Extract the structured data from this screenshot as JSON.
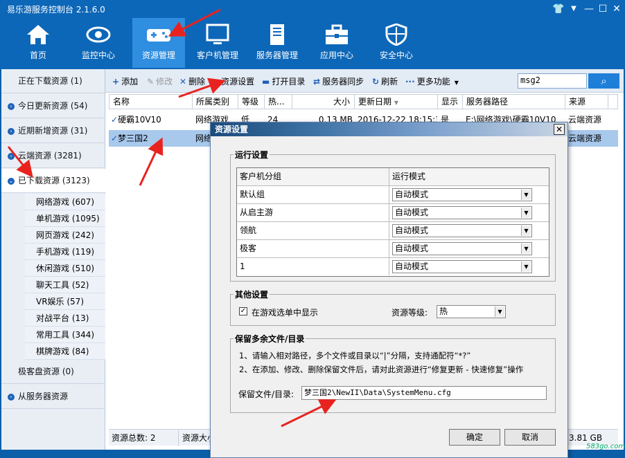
{
  "window": {
    "title": "易乐游服务控制台 2.1.6.0"
  },
  "nav": [
    {
      "label": "首页",
      "icon": "home-icon"
    },
    {
      "label": "监控中心",
      "icon": "eye-icon"
    },
    {
      "label": "资源管理",
      "icon": "gamepad-icon"
    },
    {
      "label": "客户机管理",
      "icon": "monitor-icon"
    },
    {
      "label": "服务器管理",
      "icon": "server-icon"
    },
    {
      "label": "应用中心",
      "icon": "toolbox-icon"
    },
    {
      "label": "安全中心",
      "icon": "shield-icon"
    }
  ],
  "sidebar": {
    "top": [
      {
        "label": "正在下载资源 (1)"
      },
      {
        "label": "今日更新资源 (54)"
      },
      {
        "label": "近期新增资源 (31)"
      },
      {
        "label": "云端资源 (3281)"
      },
      {
        "label": "已下载资源 (3123)"
      }
    ],
    "sub": [
      {
        "label": "网络游戏 (607)"
      },
      {
        "label": "单机游戏 (1095)"
      },
      {
        "label": "网页游戏 (242)"
      },
      {
        "label": "手机游戏 (119)"
      },
      {
        "label": "休闲游戏 (510)"
      },
      {
        "label": "聊天工具 (52)"
      },
      {
        "label": "VR娱乐 (57)"
      },
      {
        "label": "对战平台 (13)"
      },
      {
        "label": "常用工具 (344)"
      },
      {
        "label": "棋牌游戏 (84)"
      }
    ],
    "bottom": [
      {
        "label": "极客盘资源 (0)"
      },
      {
        "label": "从服务器资源"
      }
    ]
  },
  "toolbar": {
    "add": "添加",
    "edit": "修改",
    "delete": "删除",
    "settings": "资源设置",
    "open_dir": "打开目录",
    "sync": "服务器同步",
    "refresh": "刷新",
    "more": "更多功能",
    "search_value": "msg2"
  },
  "grid": {
    "headers": [
      "名称",
      "所属类别",
      "等级",
      "热...",
      "大小",
      "更新日期",
      "显示",
      "服务器路径",
      "来源"
    ],
    "rows": [
      {
        "name": "硬霸10V10",
        "category": "网络游戏",
        "level": "低",
        "heat": "24",
        "size": "0.13 MB",
        "date": "2016-12-22 18:15:30",
        "show": "是",
        "path": "E:\\网络游戏\\硬霸10V10",
        "source": "云端资源"
      },
      {
        "name": "梦三国2",
        "category": "网络游戏",
        "level": "",
        "heat": "",
        "size": "",
        "date": "",
        "show": "",
        "path": "",
        "source": "云端资源"
      }
    ]
  },
  "status": {
    "total": "资源总数: 2",
    "size": "资源大小",
    "right_value": "3.81 GB"
  },
  "dialog": {
    "title": "资源设置",
    "run_group": "运行设置",
    "col_group": "客户机分组",
    "col_mode": "运行模式",
    "run_rows": [
      {
        "group": "默认组",
        "mode": "自动模式"
      },
      {
        "group": "从启主游",
        "mode": "自动模式"
      },
      {
        "group": "领航",
        "mode": "自动模式"
      },
      {
        "group": "极客",
        "mode": "自动模式"
      },
      {
        "group": "1",
        "mode": "自动模式"
      }
    ],
    "other_group": "其他设置",
    "show_in_menu": "在游戏选单中显示",
    "level_label": "资源等级:",
    "level_value": "热",
    "keep_group": "保留多余文件/目录",
    "note1": "1、请输入相对路径，多个文件或目录以“|”分隔，支持通配符“*?”",
    "note2": "2、在添加、修改、删除保留文件后，请对此资源进行“修复更新 - 快速修复”操作",
    "keep_label": "保留文件/目录:",
    "keep_value": "梦三国2\\NewII\\Data\\SystemMenu.cfg",
    "ok": "确定",
    "cancel": "取消"
  },
  "watermark": "583go.com",
  "colors": {
    "nav_bg": "#0d67b8",
    "nav_active": "#2f8ee0",
    "accent": "#1f7fd8",
    "annotation": "#e8231f"
  }
}
